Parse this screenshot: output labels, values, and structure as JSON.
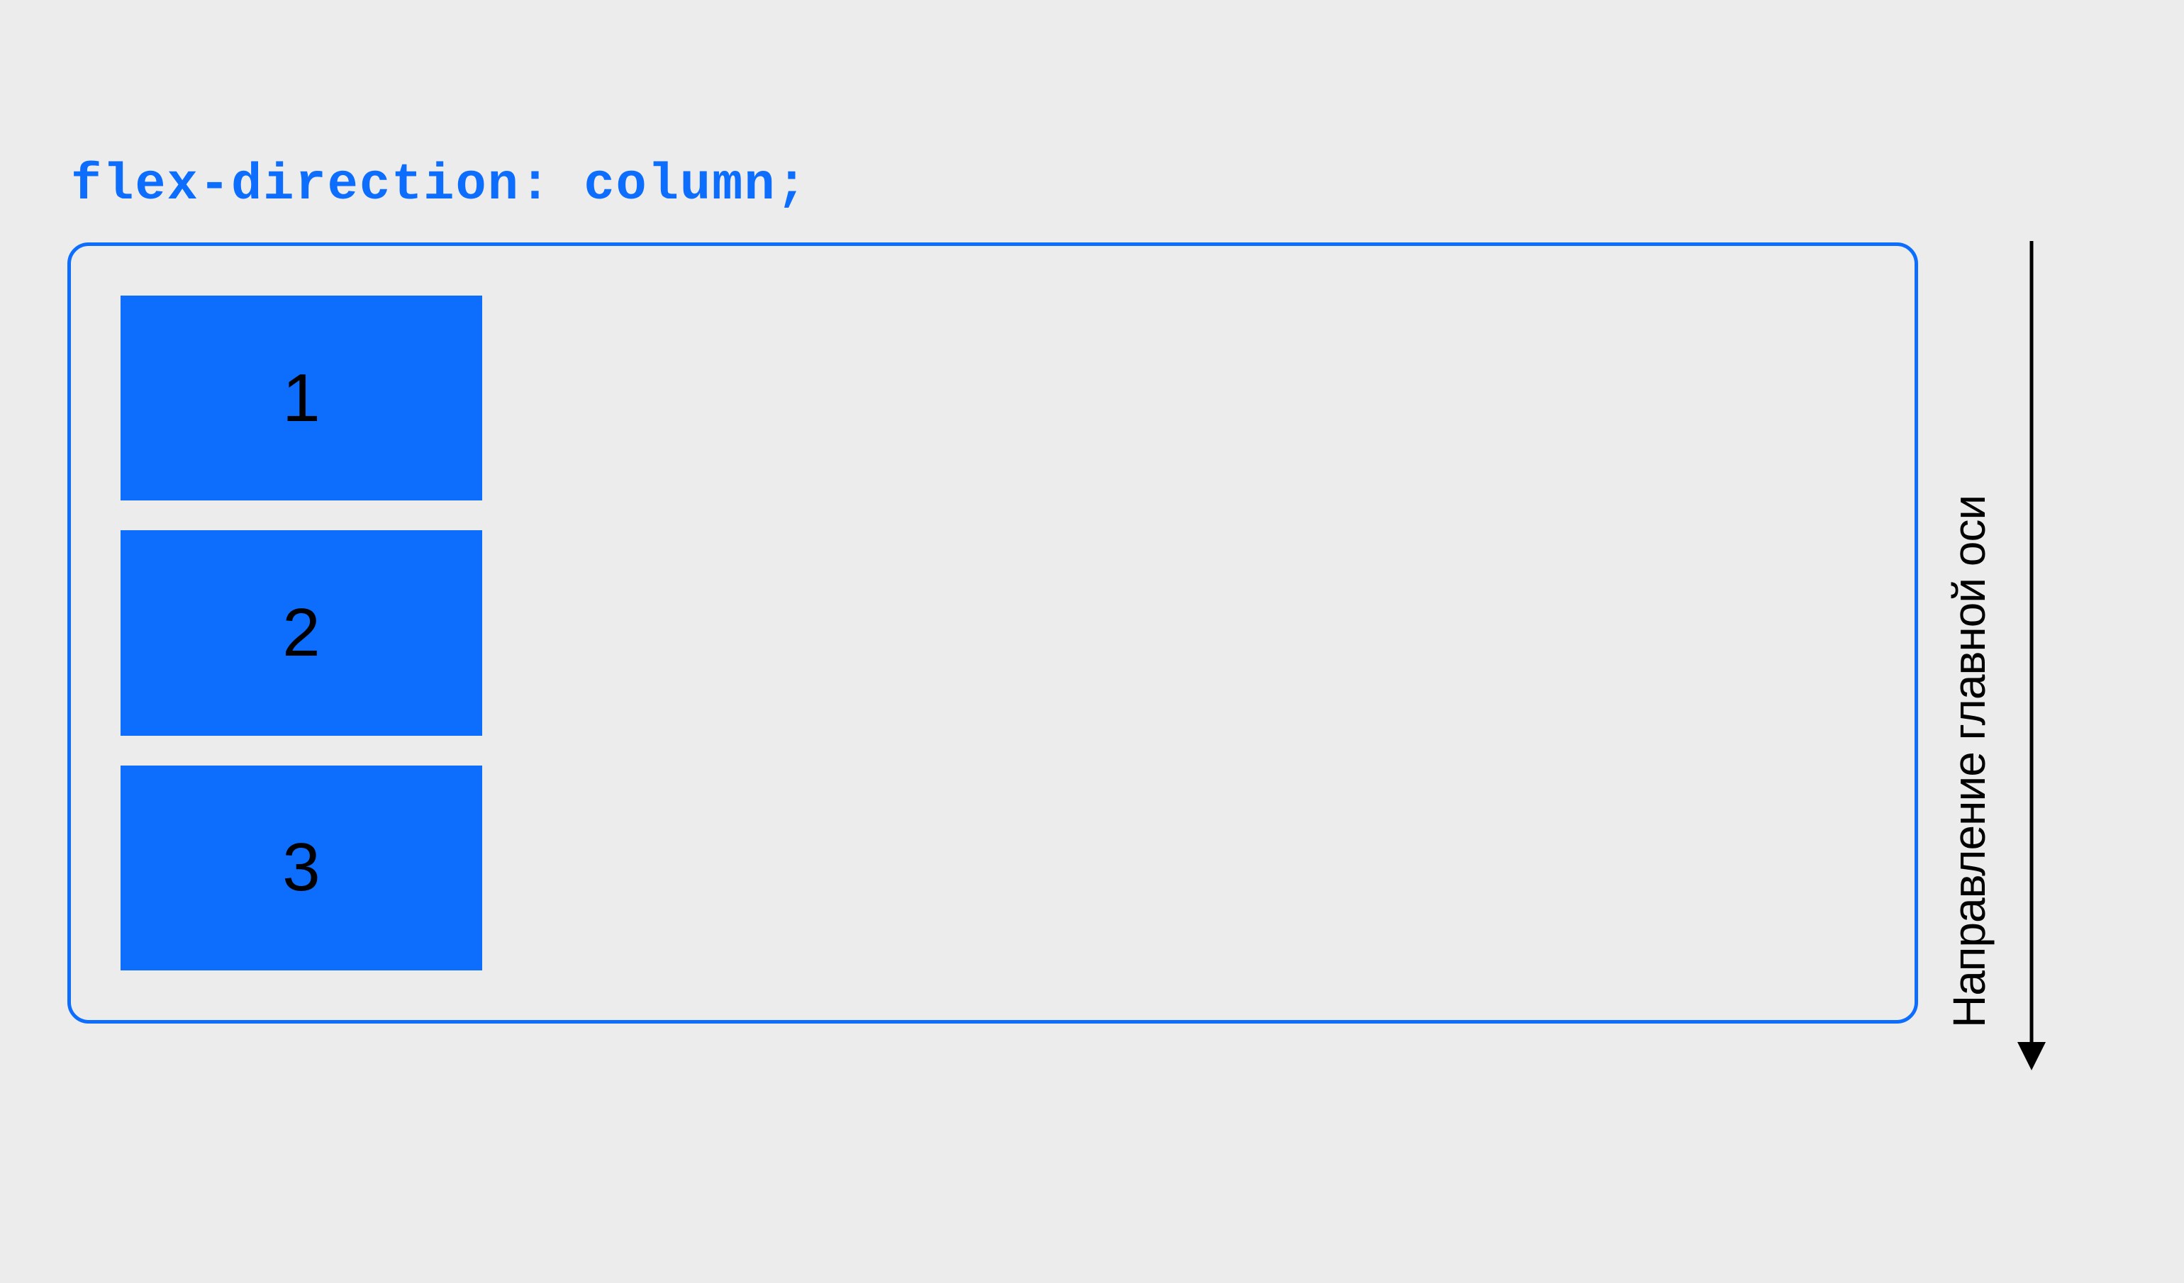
{
  "title": "flex-direction: column;",
  "items": [
    "1",
    "2",
    "3"
  ],
  "axis_label": "Направление главной оси"
}
